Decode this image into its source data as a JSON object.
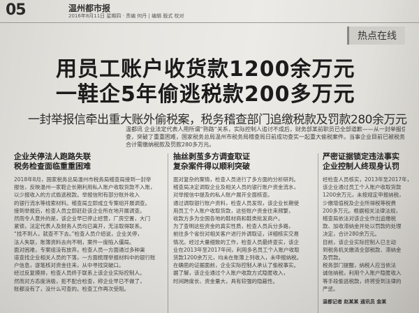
{
  "masthead": {
    "page_number": "05",
    "paper_name": "温州都市报",
    "issue_info": "2016年8月11日 星期四 · 责编 何丹 | 编辑 版式 校对"
  },
  "section_tab": "热点在线",
  "headline": {
    "line1": "用员工账户收货款1200余万元",
    "line2": "一鞋企5年偷逃税款200多万元"
  },
  "subheadline": "一封举报信牵出重大账外偷税案，税务稽查部门追缴税款及罚款280余万元",
  "lead": [
    "温都讯  企业法定代表人用所谓“熟路”关系，实际控制人追讨不成后，财务部某前职员已全部道歉——从一封举报信入手，历经半年多的调",
    "查，突破了重重困难，国家税务总局温州市税务局稽查局日前成功查实一起重大偷税案件。当事企业目前已被税务稽查部门处以罚款处理，",
    "合计需缴纳税款及罚款280多万元。"
  ],
  "col1": {
    "heading": [
      "企业关停法人跑路失联",
      "税务检查面临重重困难"
    ],
    "paragraphs": [
      "2018年8月，国家税务总局温州市税务局稽查局接到一封举",
      "报信，反映温州一家鞋企长期利用私人账户收取货款不入账，",
      "以少报收入的方式偷逃税款。举报信附有部分账外收入",
      "的银行流水等线索材料。稽查局立即成立专案组开展调查。",
      "接到举报后，检查人员立即赶赴该企业所在地开展调查。",
      "然而令人意外的是，该企业早已停止经营，厂房空置，大门",
      "紧锁，法定代表人及财务人员均已离开，无法取得联系。",
      "“找不到人，就查不下去。”检查人员介绍说，企业关停，",
      "法人失联，账簿资料去向不明，案件一度陷入僵局。",
      "面对困难，专案组没有放弃。检查人员一方面通过多种渠",
      "道查找企业相关人员的下落，一方面梳理举报材料中的银行账",
      "户信息，逐笔核对资金往来，从中寻找突破口。",
      "经过反复摸排，检查人员终于联系上该企业实际控制人。",
      "然而对方态度消极，拒不配合检查，称企业早已不做了，",
      "账都没有了，没什么可查的。检查工作再次受阻。"
    ]
  },
  "col2": {
    "heading": [
      "抽丝剥茧多方调查取证",
      "复杂案件得以顺利突破"
    ],
    "paragraphs": [
      "面对复杂的案情，检查人员进行了多方面的分析研判。",
      "稽查局决定调取企业及相关人员的银行账户资金流水，",
      "对举报信中提及的私人账户展开全面核查。",
      "通过调取银行账户资料，检查人员发现，该企业长期使",
      "用员工个人账户收取货款，这些账户资金往来频繁，",
      "收款方多为全国各地的鞋材商和鞋类批发商户。",
      "为了查明这些资金的真实性质，检查人员兵分多路，",
      "前往多个省份对相关客户进行外调取证，详细核实交易",
      "情况。经过大量细致的工作，检查人员最终查实，该企",
      "业在2013年至2017年间，利用多名员工个人账户收取",
      "货款1200余万元，均未在账簿上列收入，未申报纳税。",
      "在确凿的证据面前，企业实际控制人承认了偷税事实。",
      "据了解，该企业通过个人账户收款方式隐匿收入，",
      "时间跨度长、资金量大，具有较强的隐蔽性。"
    ]
  },
  "col3": {
    "heading": [
      "严密证据锁定违法事实",
      "企业控制人终现身认罚"
    ],
    "paragraphs": [
      "经检查人员核实，2013年至2017年，",
      "该企业通过员工个人账户收取货款",
      "1200余万元，未按规定申报纳税，",
      "少缴增值税及企业所得税等税费",
      "200多万元。根据相关法律法规，",
      "稽查局依法对该企业作出追缴税",
      "款、加收滞纳金并处以罚款的处理",
      "决定，合计280余万元。",
      "目前，该企业实际控制人已主动",
      "到税务机关缴清全部税款、滞纳金",
      "及罚款。",
      "税务部门提醒，纳税人应当依法",
      "诚信纳税，利用个人账户隐匿收入",
      "等手段偷逃税款，终将受到法律的",
      "严惩。"
    ],
    "byline": "温都记者 赵某某 通讯员 金某"
  }
}
